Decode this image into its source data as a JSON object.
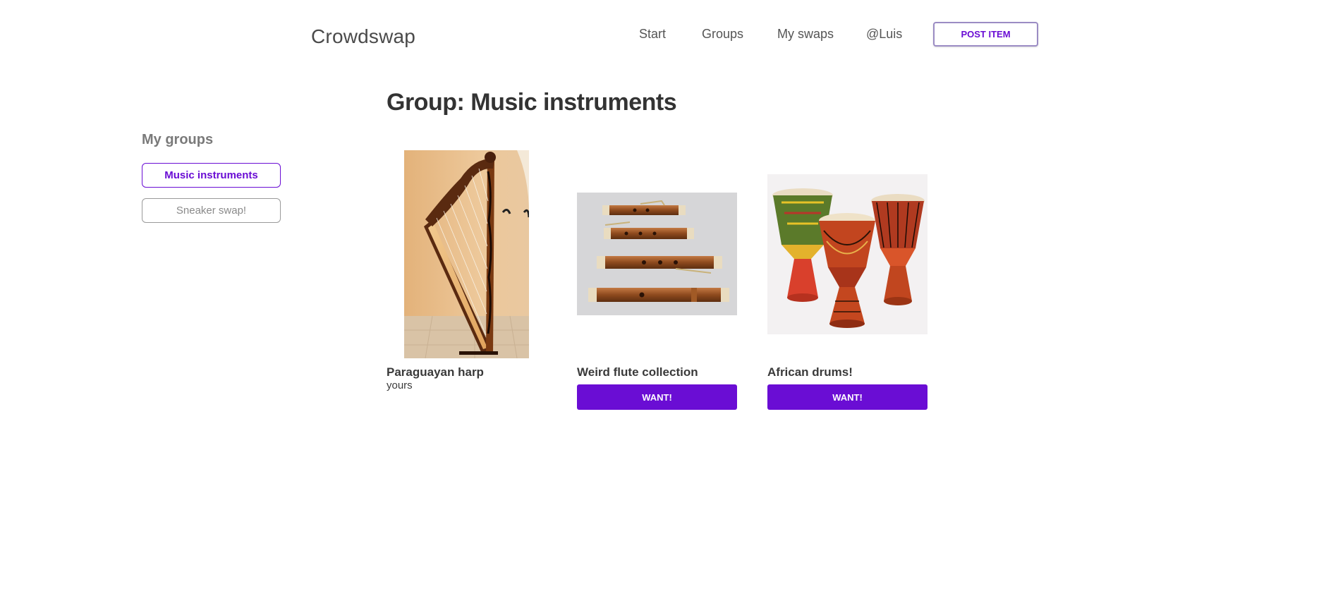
{
  "header": {
    "logo": "Crowdswap",
    "nav": [
      "Start",
      "Groups",
      "My swaps",
      "@Luis"
    ],
    "post_item": "POST ITEM"
  },
  "sidebar": {
    "title": "My groups",
    "groups": [
      "Music instruments",
      "Sneaker swap!"
    ],
    "active_group": "Music instruments"
  },
  "main": {
    "title": "Group: Music instruments",
    "items": [
      {
        "title": "Paraguayan harp",
        "owner": "yours",
        "image": "harp-image"
      },
      {
        "title": "Weird flute collection",
        "action": "WANT!",
        "image": "flutes-image"
      },
      {
        "title": "African drums!",
        "action": "WANT!",
        "image": "drums-image"
      }
    ]
  },
  "colors": {
    "accent": "#6a0dd4",
    "text": "#333333",
    "muted": "#7a7a7a"
  }
}
